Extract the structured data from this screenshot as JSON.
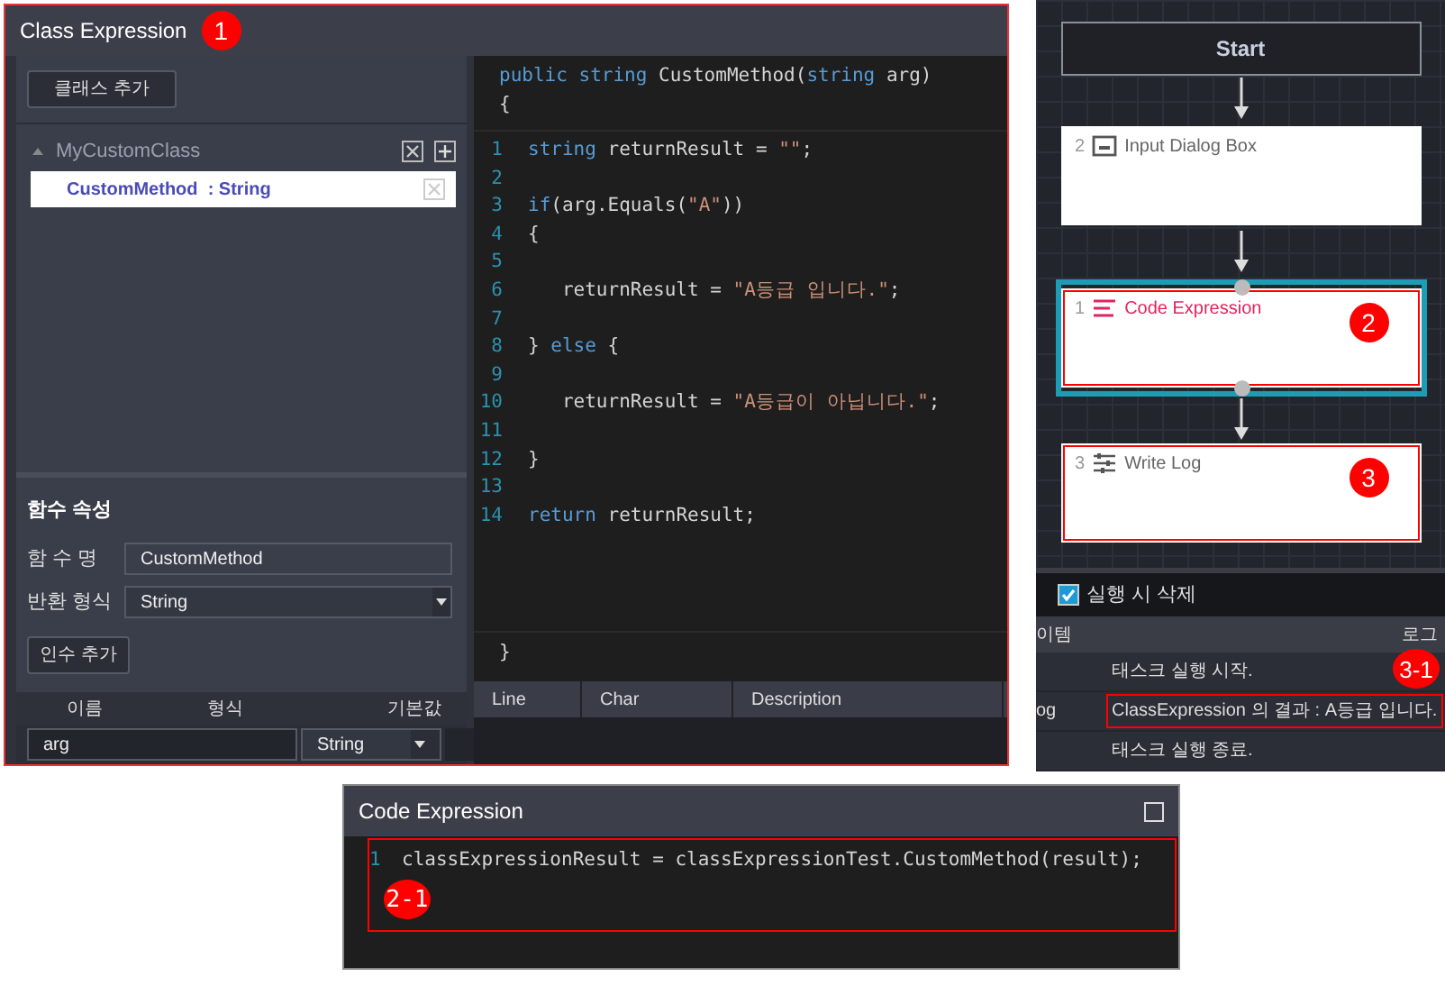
{
  "class_window": {
    "title": "Class Expression",
    "marker": "1",
    "add_class_button": "클래스 추가",
    "classes": [
      {
        "name": "MyCustomClass",
        "expanded": true,
        "methods": [
          {
            "label": "CustomMethod",
            "type": ": String",
            "selected": true
          }
        ]
      }
    ],
    "properties": {
      "title": "함수 속성",
      "name_label": "함 수 명",
      "name_value": "CustomMethod",
      "return_label": "반환 형식",
      "return_value": "String",
      "add_arg_button": "인수 추가",
      "columns": [
        "이름",
        "형식",
        "기본값"
      ],
      "args": [
        {
          "name": "arg",
          "type": "String"
        }
      ]
    },
    "code": {
      "signature": [
        {
          "kind": "keyword",
          "text": "public string"
        },
        {
          "kind": "plain",
          "text": " CustomMethod("
        },
        {
          "kind": "keyword",
          "text": "string"
        },
        {
          "kind": "plain",
          "text": " arg)"
        }
      ],
      "open_brace": "{",
      "lines": [
        {
          "number": "1",
          "tokens": [
            {
              "kind": "keyword",
              "text": "string"
            },
            {
              "kind": "plain",
              "text": " returnResult = "
            },
            {
              "kind": "string",
              "text": "\"\""
            },
            {
              "kind": "plain",
              "text": ";"
            }
          ]
        },
        {
          "number": "2"
        },
        {
          "number": "3",
          "tokens": [
            {
              "kind": "keyword",
              "text": "if"
            },
            {
              "kind": "plain",
              "text": "(arg.Equals("
            },
            {
              "kind": "string",
              "text": "\"A\""
            },
            {
              "kind": "plain",
              "text": "))"
            }
          ]
        },
        {
          "number": "4",
          "tokens": [
            {
              "kind": "plain",
              "text": "{"
            }
          ]
        },
        {
          "number": "5"
        },
        {
          "number": "6",
          "tokens": [
            {
              "kind": "plain",
              "text": "   returnResult = "
            },
            {
              "kind": "string",
              "text": "\"A등급 입니다.\""
            },
            {
              "kind": "plain",
              "text": ";"
            }
          ]
        },
        {
          "number": "7"
        },
        {
          "number": "8",
          "tokens": [
            {
              "kind": "plain",
              "text": "} "
            },
            {
              "kind": "keyword",
              "text": "else"
            },
            {
              "kind": "plain",
              "text": " {"
            }
          ]
        },
        {
          "number": "9"
        },
        {
          "number": "10",
          "tokens": [
            {
              "kind": "plain",
              "text": "   returnResult = "
            },
            {
              "kind": "string",
              "text": "\"A등급이 아닙니다.\""
            },
            {
              "kind": "plain",
              "text": ";"
            }
          ]
        },
        {
          "number": "11"
        },
        {
          "number": "12",
          "tokens": [
            {
              "kind": "plain",
              "text": "}"
            }
          ]
        },
        {
          "number": "13"
        },
        {
          "number": "14",
          "tokens": [
            {
              "kind": "keyword",
              "text": "return"
            },
            {
              "kind": "plain",
              "text": " returnResult;"
            }
          ]
        }
      ],
      "close_brace": "}"
    },
    "error_columns": [
      "Line",
      "Char",
      "Description"
    ]
  },
  "flow": {
    "nodes": [
      {
        "kind": "start",
        "label": "Start",
        "selected": false,
        "highlighted": false
      },
      {
        "kind": "dialog",
        "number": "2",
        "label": "Input Dialog Box",
        "selected": false,
        "highlighted": false
      },
      {
        "kind": "code",
        "number": "1",
        "label": "Code Expression",
        "selected": true,
        "highlighted": true,
        "marker": "2"
      },
      {
        "kind": "log",
        "number": "3",
        "label": "Write Log",
        "selected": false,
        "highlighted": true,
        "marker": "3"
      }
    ]
  },
  "log": {
    "delete_on_run": {
      "label": "실행 시 삭제",
      "checked": true
    },
    "columns": [
      "이템",
      "로그"
    ],
    "rows": [
      {
        "message": "태스크 실행 시작.",
        "highlighted": false,
        "marker": "3-1"
      },
      {
        "item": "og",
        "message": "ClassExpression 의 결과 : A등급 입니다.",
        "highlighted": true
      },
      {
        "message": "태스크 실행 종료.",
        "highlighted": false
      }
    ]
  },
  "code_window": {
    "title": "Code Expression",
    "highlighted": true,
    "marker": "2-1",
    "lines": [
      {
        "number": "1",
        "text": "classExpressionResult = classExpressionTest.CustomMethod(result);"
      }
    ]
  }
}
